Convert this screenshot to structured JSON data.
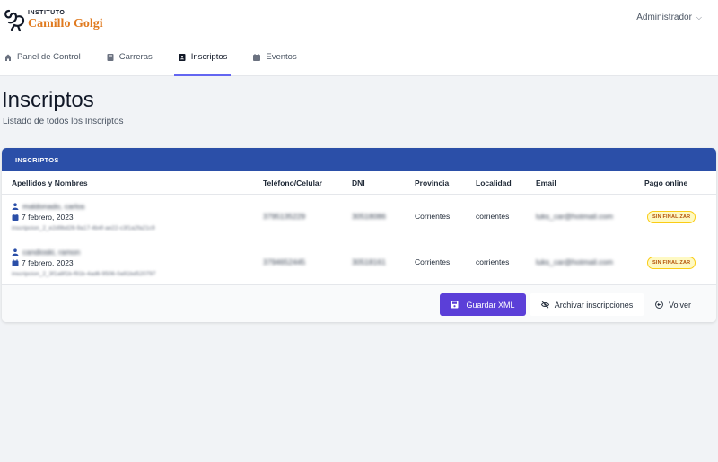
{
  "brand": {
    "small": "INSTITUTO",
    "name": "Camillo Golgi"
  },
  "user_menu": {
    "label": "Administrador"
  },
  "nav": [
    {
      "label": "Panel de Control",
      "icon": "home-icon"
    },
    {
      "label": "Carreras",
      "icon": "book-icon"
    },
    {
      "label": "Inscriptos",
      "icon": "contact-book-icon",
      "active": true
    },
    {
      "label": "Eventos",
      "icon": "calendar-icon"
    }
  ],
  "page": {
    "title": "Inscriptos",
    "subtitle": "Listado de todos los Inscriptos"
  },
  "card": {
    "header": "INSCRIPTOS"
  },
  "table": {
    "columns": [
      "Apellidos y Nombres",
      "Teléfono/Celular",
      "DNI",
      "Provincia",
      "Localidad",
      "Email",
      "Pago online"
    ],
    "rows": [
      {
        "name": "maldonado, carlos",
        "date": "7 febrero, 2023",
        "code": "inscripcion_2_e2d9bd26-9a17-4b4f-ae22-c3f1a2fa21c9",
        "phone": "3795135229",
        "dni": "30518086",
        "provincia": "Corrientes",
        "localidad": "corrientes",
        "email": "luks_car@hotmail.com",
        "pago": "SIN FINALIZAR"
      },
      {
        "name": "candioski, ramon",
        "date": "7 febrero, 2023",
        "code": "inscripcion_2_3f1a8f1b-f91b-4ad6-9506-0a91bd520797",
        "phone": "3794652445",
        "dni": "30518161",
        "provincia": "Corrientes",
        "localidad": "corrientes",
        "email": "luks_car@hotmail.com",
        "pago": "SIN FINALIZAR"
      }
    ]
  },
  "actions": {
    "save": "Guardar XML",
    "archive": "Archivar inscripciones",
    "back": "Volver"
  },
  "colors": {
    "header": "#2b4fa8",
    "primary": "#5b3fd8",
    "brand": "#e07a1f",
    "badge": "#facc15"
  }
}
